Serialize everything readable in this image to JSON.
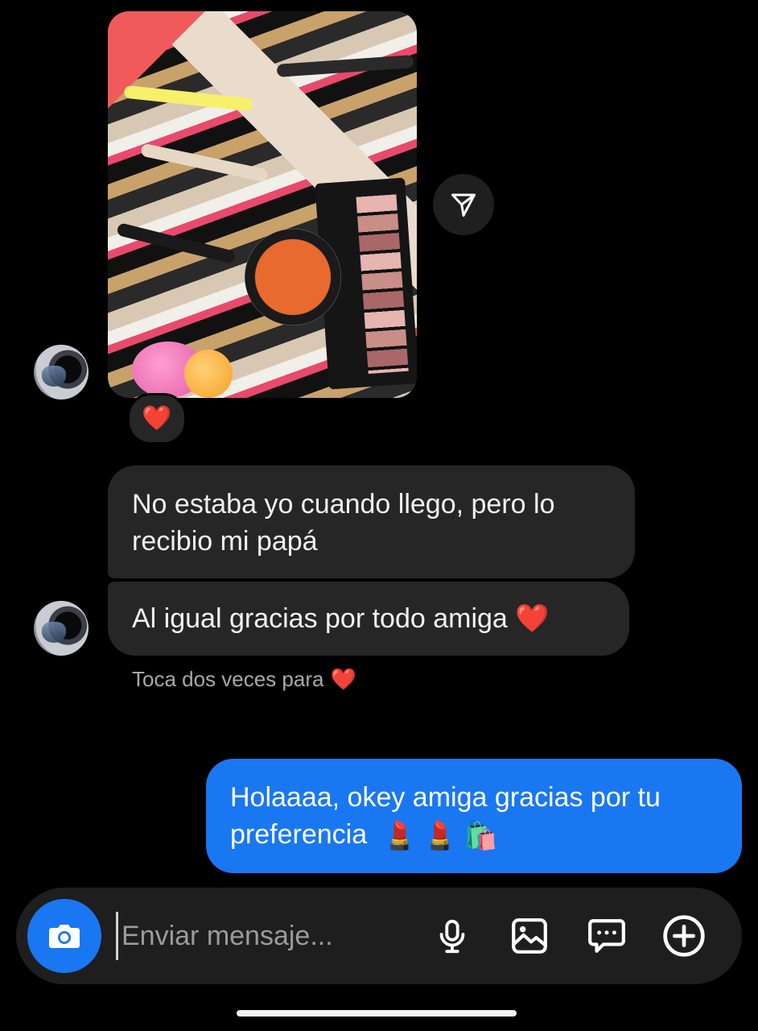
{
  "thread": {
    "photo_name": "makeup-products-photo",
    "photo_reaction": "❤️",
    "messages_received": [
      "No estaba yo cuando llego, pero lo recibio mi papá",
      "Al igual gracias por todo amiga ❤️"
    ],
    "hint": "Toca dos veces para",
    "hint_emoji": "❤️",
    "message_sent": "Holaaaa, okey amiga gracias por tu preferencia",
    "message_sent_emojis": [
      "💄",
      "💄",
      "🛍️"
    ]
  },
  "composer": {
    "placeholder": "Enviar mensaje...",
    "icons": [
      "camera-icon",
      "microphone-icon",
      "gallery-icon",
      "sticker-icon",
      "plus-icon"
    ]
  },
  "colors": {
    "background": "#000000",
    "received_bubble": "#262626",
    "sent_bubble": "#1a77f2",
    "accent": "#1a77f2"
  }
}
